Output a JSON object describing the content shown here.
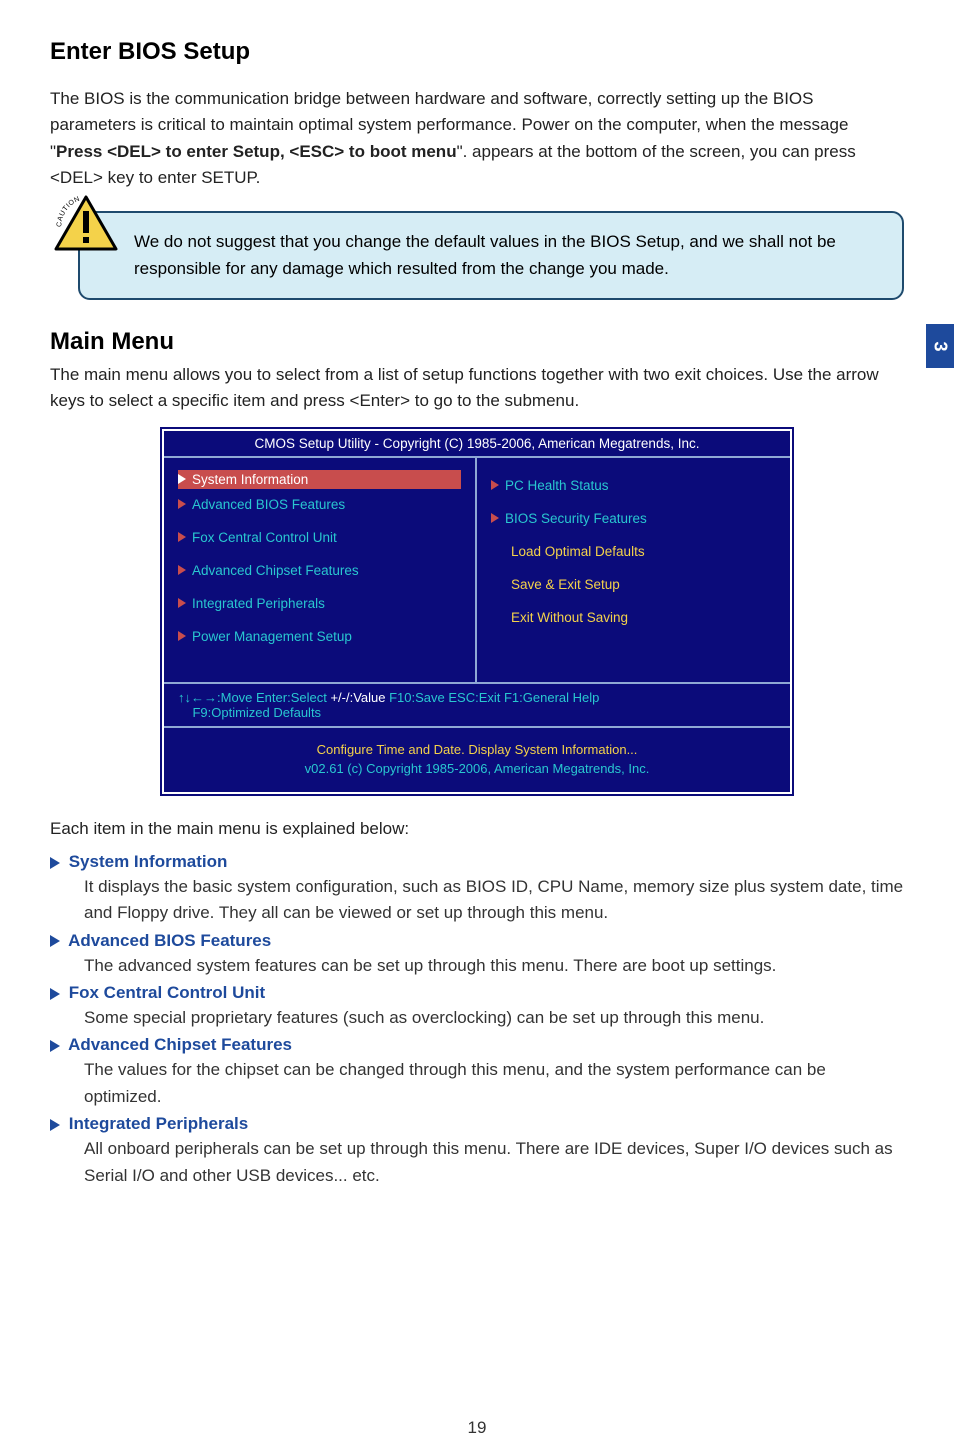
{
  "section1": {
    "title": "Enter BIOS Setup",
    "para_pre": "The BIOS is the communication bridge between hardware and software, correctly setting up the BIOS parameters is critical to maintain optimal system performance. Power on the computer, when the message \"",
    "para_bold": "Press <DEL> to enter Setup, <ESC> to boot menu",
    "para_post": "\". appears at the bottom of the screen, you can press <DEL> key to enter SETUP."
  },
  "caution": {
    "text": "We do not suggest that you change the default values in the BIOS Setup, and we shall not be responsible for any damage which resulted from the change you made."
  },
  "section2": {
    "title": "Main Menu",
    "para": "The main menu allows you to select from a list of setup functions together with two exit choices. Use the arrow keys to select a specific item and press <Enter> to go to the submenu."
  },
  "bios": {
    "title": "CMOS Setup Utility - Copyright (C) 1985-2006, American Megatrends, Inc.",
    "left_items": [
      {
        "label": "System Information",
        "tri": true,
        "selected": true
      },
      {
        "label": "Advanced BIOS Features",
        "tri": true
      },
      {
        "label": "Fox Central Control Unit",
        "tri": true
      },
      {
        "label": "Advanced Chipset Features",
        "tri": true
      },
      {
        "label": "Integrated Peripherals",
        "tri": true
      },
      {
        "label": "Power Management Setup",
        "tri": true
      }
    ],
    "right_items": [
      {
        "label": "PC Health Status",
        "tri": true,
        "cls": "cyan"
      },
      {
        "label": "BIOS Security Features",
        "tri": true,
        "cls": "cyan"
      },
      {
        "label": "Load Optimal Defaults",
        "tri": false,
        "cls": "yellow"
      },
      {
        "label": "Save & Exit Setup",
        "tri": false,
        "cls": "yellow"
      },
      {
        "label": "Exit Without Saving",
        "tri": false,
        "cls": "yellow"
      }
    ],
    "help_line1_left": "↑↓←→:Move   Enter:Select     ",
    "help_line1_white": "+/-/:Value",
    "help_line1_right": "     F10:Save       ESC:Exit     F1:General Help",
    "help_line2": "F9:Optimized Defaults",
    "footer1": "Configure Time and Date.   Display System Information...",
    "footer2": "v02.61   (c) Copyright 1985-2006, American Megatrends, Inc."
  },
  "explain_intro": "Each item in the main menu is explained below:",
  "items": [
    {
      "title": "System Information",
      "body": "It displays the basic system configuration, such as BIOS ID, CPU Name, memory size plus system date, time and Floppy drive. They all can be viewed or set up through this menu."
    },
    {
      "title": "Advanced BIOS Features",
      "body": "The advanced system features can be set up through this menu. There are boot up settings."
    },
    {
      "title": "Fox Central Control Unit",
      "body": "Some special proprietary features (such as overclocking) can be set up through this menu."
    },
    {
      "title": "Advanced Chipset Features",
      "body": "The values for the chipset can be changed through this menu, and the system performance can be optimized."
    },
    {
      "title": "Integrated Peripherals",
      "body": "All onboard peripherals can be set up through this menu. There are IDE devices, Super I/O devices such as Serial I/O and other USB devices... etc."
    }
  ],
  "side_tab": "3",
  "page_num": "19"
}
